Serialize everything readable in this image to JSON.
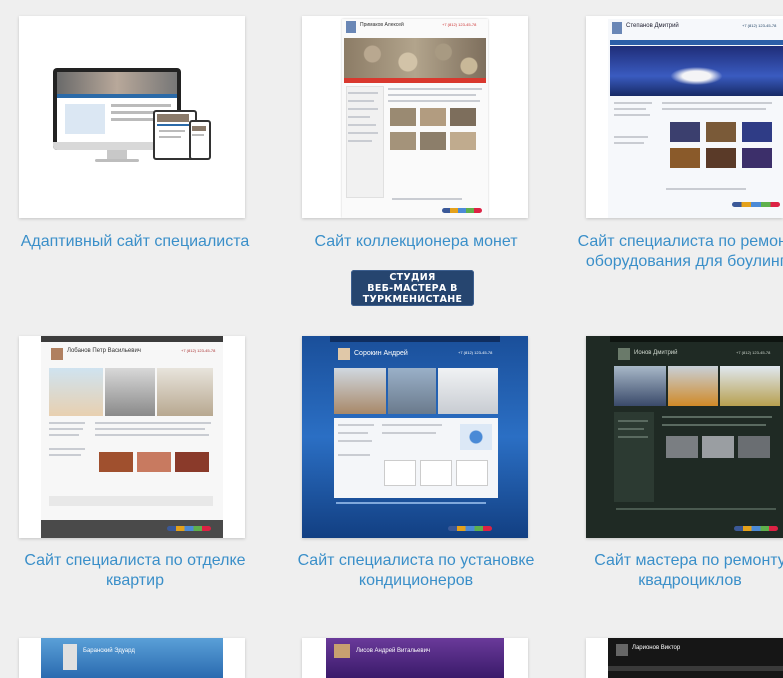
{
  "badge": {
    "line1": "СТУДИЯ",
    "line2": "ВЕБ-МАСТЕРА В",
    "line3": "ТУРКМЕНИСТАНЕ"
  },
  "portfolio": {
    "items": [
      {
        "caption": "Адаптивный сайт специалиста",
        "thumb_icon": "devices-mockup-icon"
      },
      {
        "caption": "Сайт коллекционера монет",
        "thumb_icon": "coins-site-icon",
        "site_owner": "Примаков Алексей",
        "site_phone": "+7 (812) 123-45-78"
      },
      {
        "caption": "Сайт специалиста по ремонту оборудования для боулинга",
        "thumb_icon": "bowling-site-icon",
        "site_owner": "Степанов Дмитрий",
        "site_phone": "+7 (812) 123-45-78"
      },
      {
        "caption": "Сайт специалиста по отделке квартир",
        "thumb_icon": "renovation-site-icon",
        "site_owner": "Лобанов Петр Васильевич",
        "site_phone": "+7 (812) 123-45-78"
      },
      {
        "caption": "Сайт специалиста по установке кондиционеров",
        "thumb_icon": "aircon-site-icon",
        "site_owner": "Сорокин Андрей",
        "site_phone": "+7 (812) 123-45-78"
      },
      {
        "caption": "Сайт мастера по ремонту квадроциклов",
        "thumb_icon": "atv-site-icon",
        "site_owner": "Ионов Дмитрий",
        "site_phone": "+7 (812) 123-45-78"
      },
      {
        "caption": "",
        "thumb_icon": "partial-site-icon",
        "site_owner": "Баранский Эдуард"
      },
      {
        "caption": "",
        "thumb_icon": "partial-site-icon",
        "site_owner": "Лисов Андрей Витальевич"
      },
      {
        "caption": "",
        "thumb_icon": "partial-site-icon",
        "site_owner": "Ларионов Виктор"
      }
    ]
  },
  "colors": {
    "caption": "#3a8fc9",
    "background": "#efefef",
    "badge": "#26456f"
  }
}
